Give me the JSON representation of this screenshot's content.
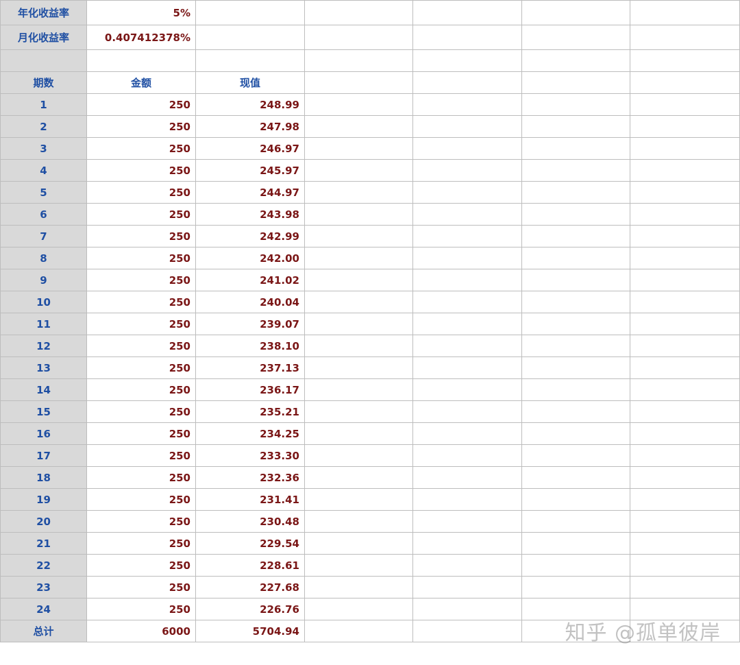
{
  "params": {
    "annual_label": "年化收益率",
    "annual_value": "5%",
    "monthly_label": "月化收益率",
    "monthly_value": "0.407412378%"
  },
  "headers": {
    "period": "期数",
    "amount": "金额",
    "pv": "现值"
  },
  "rows": [
    {
      "period": "1",
      "amount": "250",
      "pv": "248.99"
    },
    {
      "period": "2",
      "amount": "250",
      "pv": "247.98"
    },
    {
      "period": "3",
      "amount": "250",
      "pv": "246.97"
    },
    {
      "period": "4",
      "amount": "250",
      "pv": "245.97"
    },
    {
      "period": "5",
      "amount": "250",
      "pv": "244.97"
    },
    {
      "period": "6",
      "amount": "250",
      "pv": "243.98"
    },
    {
      "period": "7",
      "amount": "250",
      "pv": "242.99"
    },
    {
      "period": "8",
      "amount": "250",
      "pv": "242.00"
    },
    {
      "period": "9",
      "amount": "250",
      "pv": "241.02"
    },
    {
      "period": "10",
      "amount": "250",
      "pv": "240.04"
    },
    {
      "period": "11",
      "amount": "250",
      "pv": "239.07"
    },
    {
      "period": "12",
      "amount": "250",
      "pv": "238.10"
    },
    {
      "period": "13",
      "amount": "250",
      "pv": "237.13"
    },
    {
      "period": "14",
      "amount": "250",
      "pv": "236.17"
    },
    {
      "period": "15",
      "amount": "250",
      "pv": "235.21"
    },
    {
      "period": "16",
      "amount": "250",
      "pv": "234.25"
    },
    {
      "period": "17",
      "amount": "250",
      "pv": "233.30"
    },
    {
      "period": "18",
      "amount": "250",
      "pv": "232.36"
    },
    {
      "period": "19",
      "amount": "250",
      "pv": "231.41"
    },
    {
      "period": "20",
      "amount": "250",
      "pv": "230.48"
    },
    {
      "period": "21",
      "amount": "250",
      "pv": "229.54"
    },
    {
      "period": "22",
      "amount": "250",
      "pv": "228.61"
    },
    {
      "period": "23",
      "amount": "250",
      "pv": "227.68"
    },
    {
      "period": "24",
      "amount": "250",
      "pv": "226.76"
    }
  ],
  "total": {
    "label": "总计",
    "amount": "6000",
    "pv": "5704.94"
  },
  "watermark": "知乎 @孤单彼岸"
}
